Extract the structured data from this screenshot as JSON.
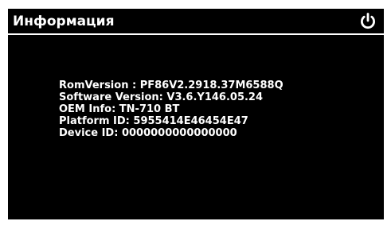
{
  "window": {
    "title": "Информация",
    "power_icon": "power-icon"
  },
  "info": {
    "lines": [
      "RomVersion : PF86V2.2918.37M6588Q",
      "Software Version: V3.6.Y146.05.24",
      "OEM Info: TN-710 BT",
      "Platform ID: 5955414E46454E47",
      "Device ID: 0000000000000000"
    ]
  },
  "colors": {
    "background": "#000000",
    "text": "#ffffff",
    "frame": "#ffffff"
  }
}
